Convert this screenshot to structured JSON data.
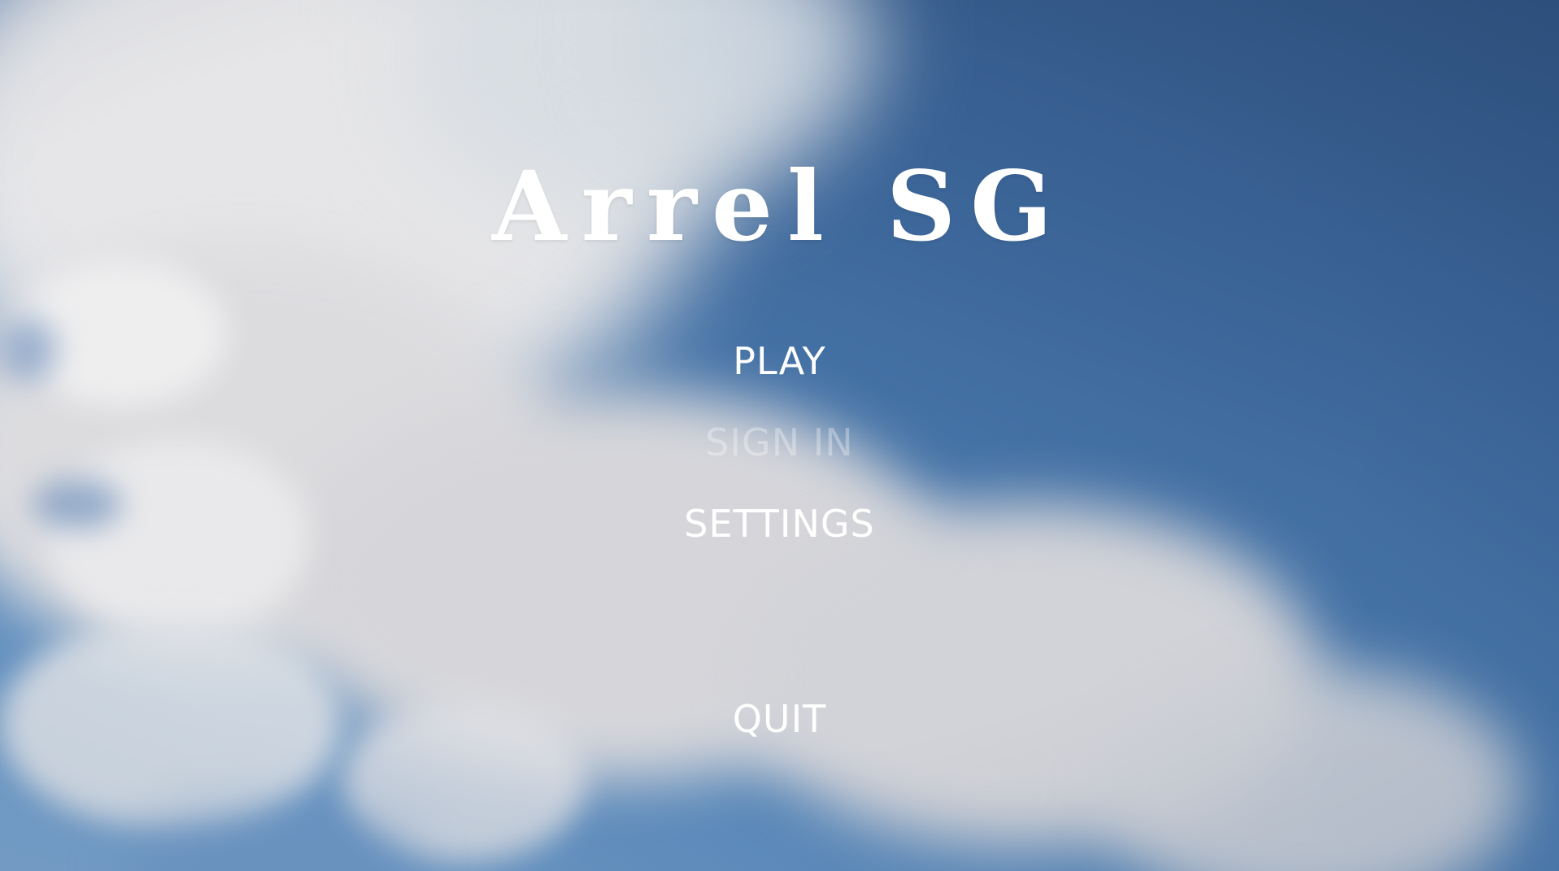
{
  "game": {
    "title": "Arrel SG"
  },
  "menu": {
    "items": [
      {
        "label": "PLAY",
        "state": "enabled"
      },
      {
        "label": "SIGN IN",
        "state": "disabled"
      },
      {
        "label": "SETTINGS",
        "state": "enabled"
      },
      {
        "label": "QUIT",
        "state": "enabled"
      }
    ]
  },
  "colors": {
    "text": "#ffffff",
    "sky_dark": "#2f527f",
    "sky_light": "#7aa3cc",
    "cloud": "#e3e3e6"
  }
}
